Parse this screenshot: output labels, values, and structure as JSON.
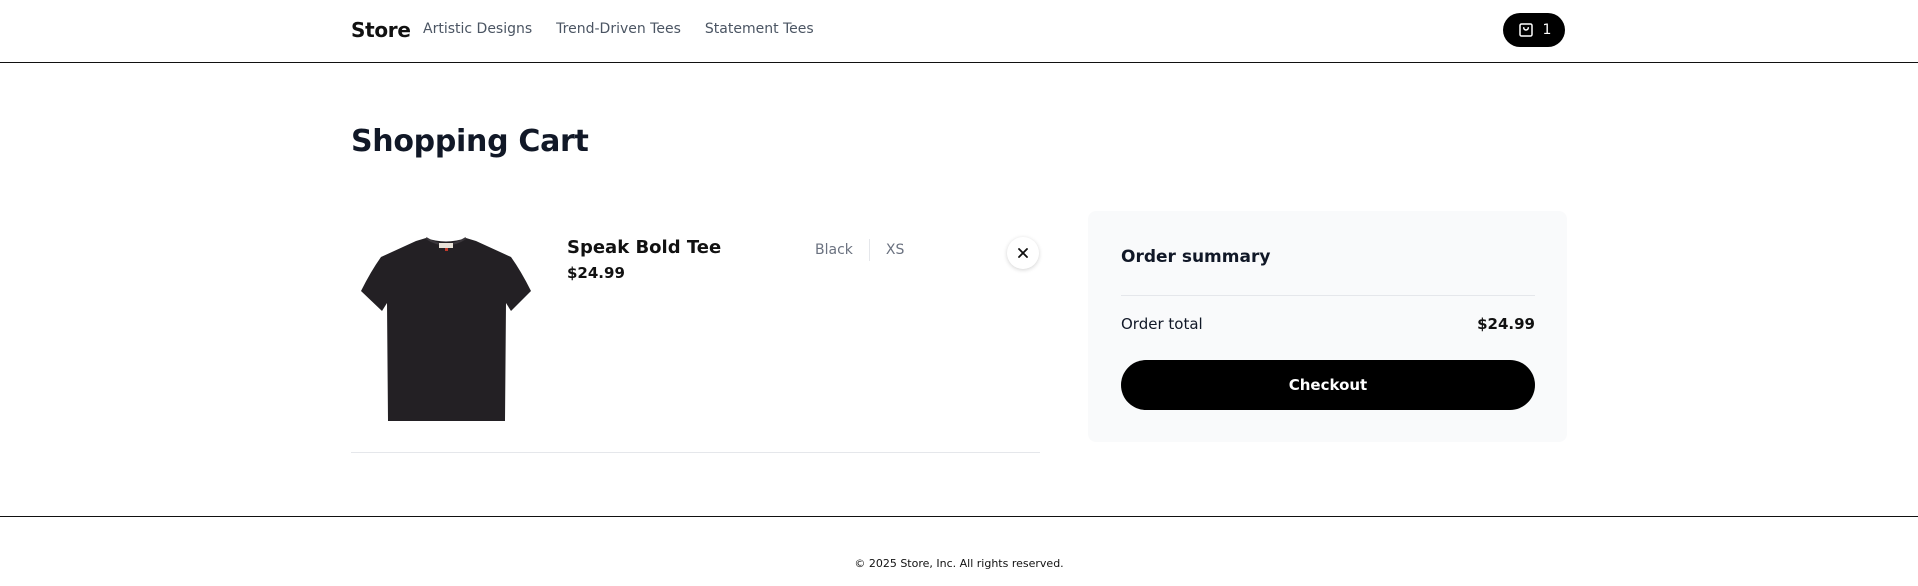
{
  "header": {
    "brand": "Store",
    "nav": [
      "Artistic Designs",
      "Trend-Driven Tees",
      "Statement Tees"
    ],
    "cart_count": "1",
    "cart_icon": "shopping-bag-icon"
  },
  "main": {
    "title": "Shopping Cart",
    "items": [
      {
        "name": "Speak Bold Tee",
        "price": "$24.99",
        "color": "Black",
        "size": "XS",
        "image": "black-tshirt-image",
        "remove_icon": "close-icon"
      }
    ]
  },
  "summary": {
    "title": "Order summary",
    "total_label": "Order total",
    "total_value": "$24.99",
    "checkout_label": "Checkout"
  },
  "footer": {
    "copyright": "© 2025 Store, Inc. All rights reserved."
  },
  "colors": {
    "primary": "#000000",
    "summary_bg": "#f9fafb",
    "muted_text": "#6b7280"
  }
}
